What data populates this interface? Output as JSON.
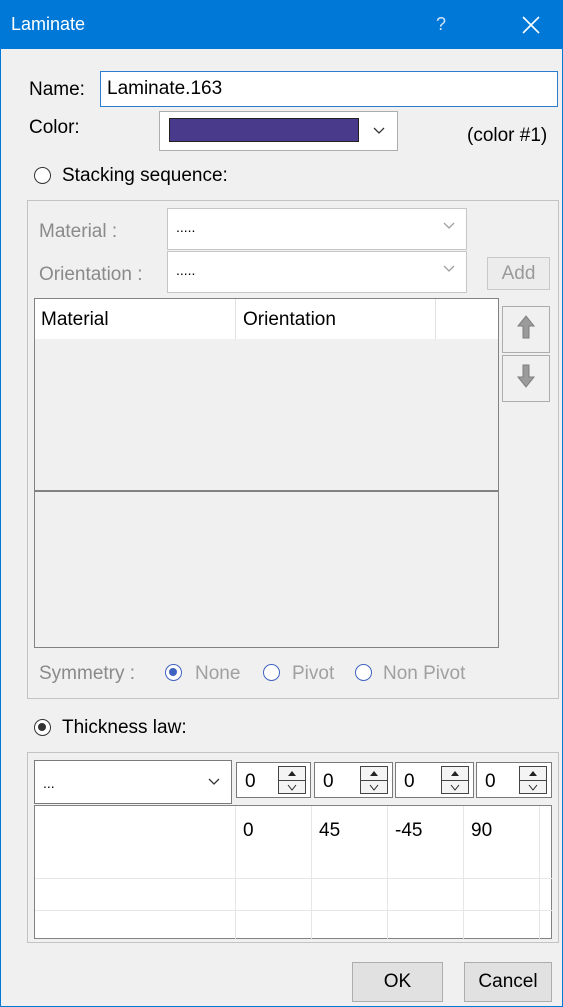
{
  "window": {
    "title": "Laminate",
    "help": "?"
  },
  "name": {
    "label": "Name:",
    "value": "Laminate.163"
  },
  "color": {
    "label": "Color:",
    "swatch": "#4a3a8c",
    "note": "(color #1)"
  },
  "stacking": {
    "radio_label": "Stacking sequence:",
    "material_label": "Material :",
    "material_value": ".....",
    "orientation_label": "Orientation :",
    "orientation_value": ".....",
    "add_label": "Add",
    "columns": [
      "Material",
      "Orientation"
    ],
    "symmetry_label": "Symmetry :",
    "symmetry_options": [
      "None",
      "Pivot",
      "Non Pivot"
    ]
  },
  "thickness": {
    "radio_label": "Thickness law:",
    "combo_value": "...",
    "spinners": [
      "0",
      "0",
      "0",
      "0"
    ],
    "angles": [
      "0",
      "45",
      "-45",
      "90"
    ]
  },
  "footer": {
    "ok": "OK",
    "cancel": "Cancel"
  },
  "icons": [
    "chevron-down-icon",
    "close-icon",
    "arrow-up-icon",
    "arrow-down-icon",
    "spin-up-icon",
    "spin-down-icon"
  ]
}
